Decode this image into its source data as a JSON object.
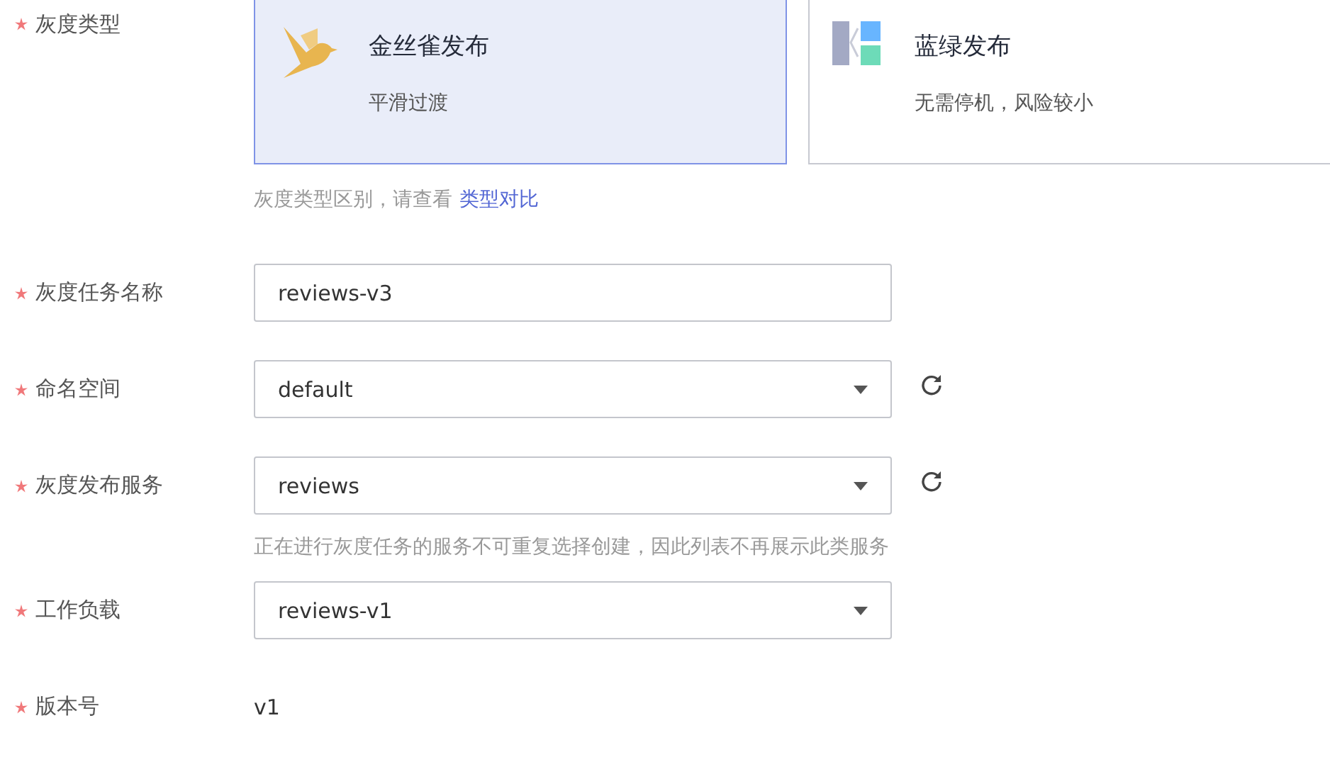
{
  "fields": [
    {
      "kind": "cards",
      "label": "灰度类型",
      "required": true,
      "options": [
        {
          "kind": "bird",
          "title": "金丝雀发布",
          "description": "平滑过渡",
          "selected": true
        },
        {
          "kind": "blocks",
          "title": "蓝绿发布",
          "description": "无需停机，风险较小",
          "selected": false
        }
      ],
      "hint": "灰度类型区别，请查看",
      "hint_link": "类型对比"
    },
    {
      "kind": "input",
      "label": "灰度任务名称",
      "required": true,
      "value": "reviews-v3"
    },
    {
      "kind": "select",
      "label": "命名空间",
      "required": true,
      "value": "default",
      "refresh": true
    },
    {
      "kind": "select",
      "label": "灰度发布服务",
      "required": true,
      "value": "reviews",
      "refresh": true,
      "hint": "正在进行灰度任务的服务不可重复选择创建，因此列表不再展示此类服务"
    },
    {
      "kind": "select",
      "label": "工作负载",
      "required": true,
      "value": "reviews-v1",
      "refresh": false
    },
    {
      "kind": "text",
      "label": "版本号",
      "required": true,
      "value": "v1"
    }
  ]
}
